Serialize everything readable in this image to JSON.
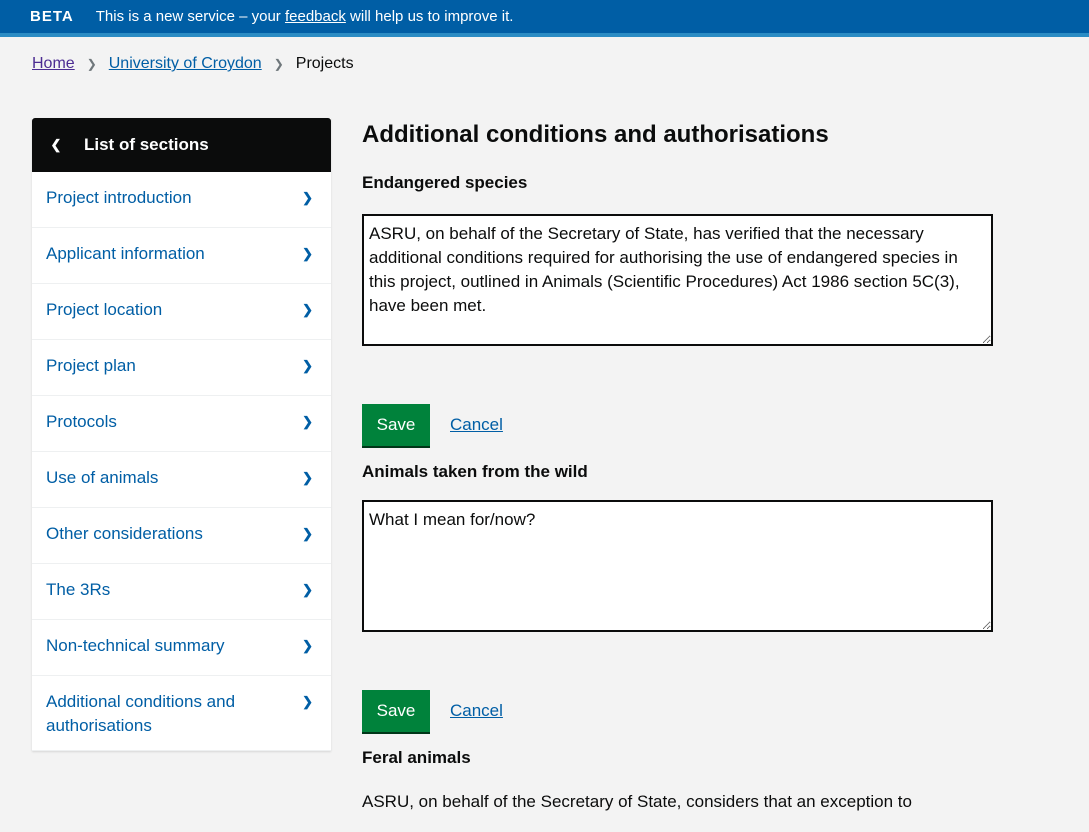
{
  "banner": {
    "tag": "BETA",
    "message_prefix": "This is a new service – your ",
    "feedback_link": "feedback",
    "message_suffix": " will help us to improve it."
  },
  "breadcrumb": {
    "home": "Home",
    "establishment": "University of Croydon",
    "current": "Projects"
  },
  "sidebar": {
    "header_label": "List of sections",
    "header_icon": "chevron-left-icon",
    "items": [
      {
        "label": "Project introduction"
      },
      {
        "label": "Applicant information"
      },
      {
        "label": "Project location"
      },
      {
        "label": "Project plan"
      },
      {
        "label": "Protocols"
      },
      {
        "label": "Use of animals"
      },
      {
        "label": "Other considerations"
      },
      {
        "label": "The 3Rs"
      },
      {
        "label": "Non-technical summary"
      },
      {
        "label": "Additional conditions and authorisations"
      }
    ]
  },
  "main": {
    "title": "Additional conditions and authorisations",
    "endangered": {
      "label": "Endangered species",
      "value": "ASRU, on behalf of the Secretary of State, has verified that the necessary additional conditions required for authorising the use of endangered species in this project, outlined in Animals (Scientific Procedures) Act 1986 section 5C(3), have been met."
    },
    "wild": {
      "label": "Animals taken from the wild",
      "value": "What I mean for/now?"
    },
    "feral": {
      "label": "Feral animals",
      "value": "ASRU, on behalf of the Secretary of State, considers that an exception to"
    },
    "save_label": "Save",
    "cancel_label": "Cancel"
  },
  "colors": {
    "banner": "#005ea5",
    "link": "#005ea5",
    "save_button": "#00823b",
    "sidebar_header": "#0b0c0c",
    "background": "#f3f3f3"
  }
}
